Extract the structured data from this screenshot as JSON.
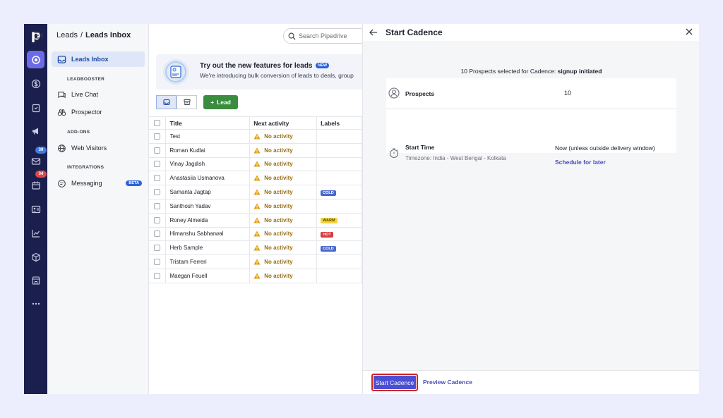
{
  "app": {
    "logo": "p"
  },
  "rail": {
    "items": [
      {
        "icon": "target-icon",
        "active": true
      },
      {
        "icon": "dollar-icon"
      },
      {
        "icon": "clipboard-icon"
      },
      {
        "icon": "megaphone-icon"
      },
      {
        "icon": "mail-icon",
        "badge": "39",
        "badge_color": "#3f7be0"
      },
      {
        "icon": "calendar-icon",
        "badge": "34",
        "badge_color": "#e04848"
      },
      {
        "icon": "contacts-icon"
      },
      {
        "icon": "chart-icon"
      },
      {
        "icon": "box-icon"
      },
      {
        "icon": "store-icon"
      },
      {
        "icon": "more-icon"
      }
    ]
  },
  "breadcrumb": {
    "parent": "Leads",
    "separator": "/",
    "current": "Leads Inbox"
  },
  "search": {
    "placeholder": "Search Pipedrive"
  },
  "sidebar": {
    "leads_inbox": "Leads Inbox",
    "section_leadbooster": "LEADBOOSTER",
    "live_chat": "Live Chat",
    "prospector": "Prospector",
    "section_addons": "ADD-ONS",
    "web_visitors": "Web Visitors",
    "section_integrations": "INTEGRATIONS",
    "messaging": "Messaging",
    "messaging_badge": "BETA"
  },
  "banner": {
    "title": "Try out the new features for leads",
    "badge": "NEW",
    "subtitle": "We're introducing bulk conversion of leads to deals, group"
  },
  "toolbar": {
    "add_lead": "Lead"
  },
  "table": {
    "columns": {
      "title": "Title",
      "activity": "Next activity",
      "labels": "Labels"
    },
    "rows": [
      {
        "title": "Test",
        "activity": "No activity",
        "label": ""
      },
      {
        "title": "Roman Kudlai",
        "activity": "No activity",
        "label": ""
      },
      {
        "title": "Vinay Jagdish",
        "activity": "No activity",
        "label": ""
      },
      {
        "title": "Anastasiia Usmanova",
        "activity": "No activity",
        "label": ""
      },
      {
        "title": "Samanta Jagtap",
        "activity": "No activity",
        "label": "COLD"
      },
      {
        "title": "Santhosh Yadav",
        "activity": "No activity",
        "label": ""
      },
      {
        "title": "Roney Almeida",
        "activity": "No activity",
        "label": "WARM"
      },
      {
        "title": "Himanshu Sabharwal",
        "activity": "No activity",
        "label": "HOT"
      },
      {
        "title": "Herb Sample",
        "activity": "No activity",
        "label": "COLD"
      },
      {
        "title": "Tristam Ferreri",
        "activity": "No activity",
        "label": ""
      },
      {
        "title": "Maegan Feuell",
        "activity": "No activity",
        "label": ""
      }
    ]
  },
  "label_colors": {
    "COLD": "#4a68c9",
    "WARM": "#f4d33c",
    "HOT": "#d43b3b"
  },
  "panel": {
    "title": "Start Cadence",
    "selection_prefix": "10 Prospects selected for Cadence:",
    "selection_name": "signup initiated",
    "prospects_label": "Prospects",
    "prospects_value": "10",
    "start_time_label": "Start Time",
    "timezone": "Timezone: India - West Bengal - Kolkata",
    "start_time_value": "Now (unless outside delivery window)",
    "schedule_link": "Schedule for later",
    "start_button": "Start Cadence",
    "preview_button": "Preview Cadence"
  }
}
